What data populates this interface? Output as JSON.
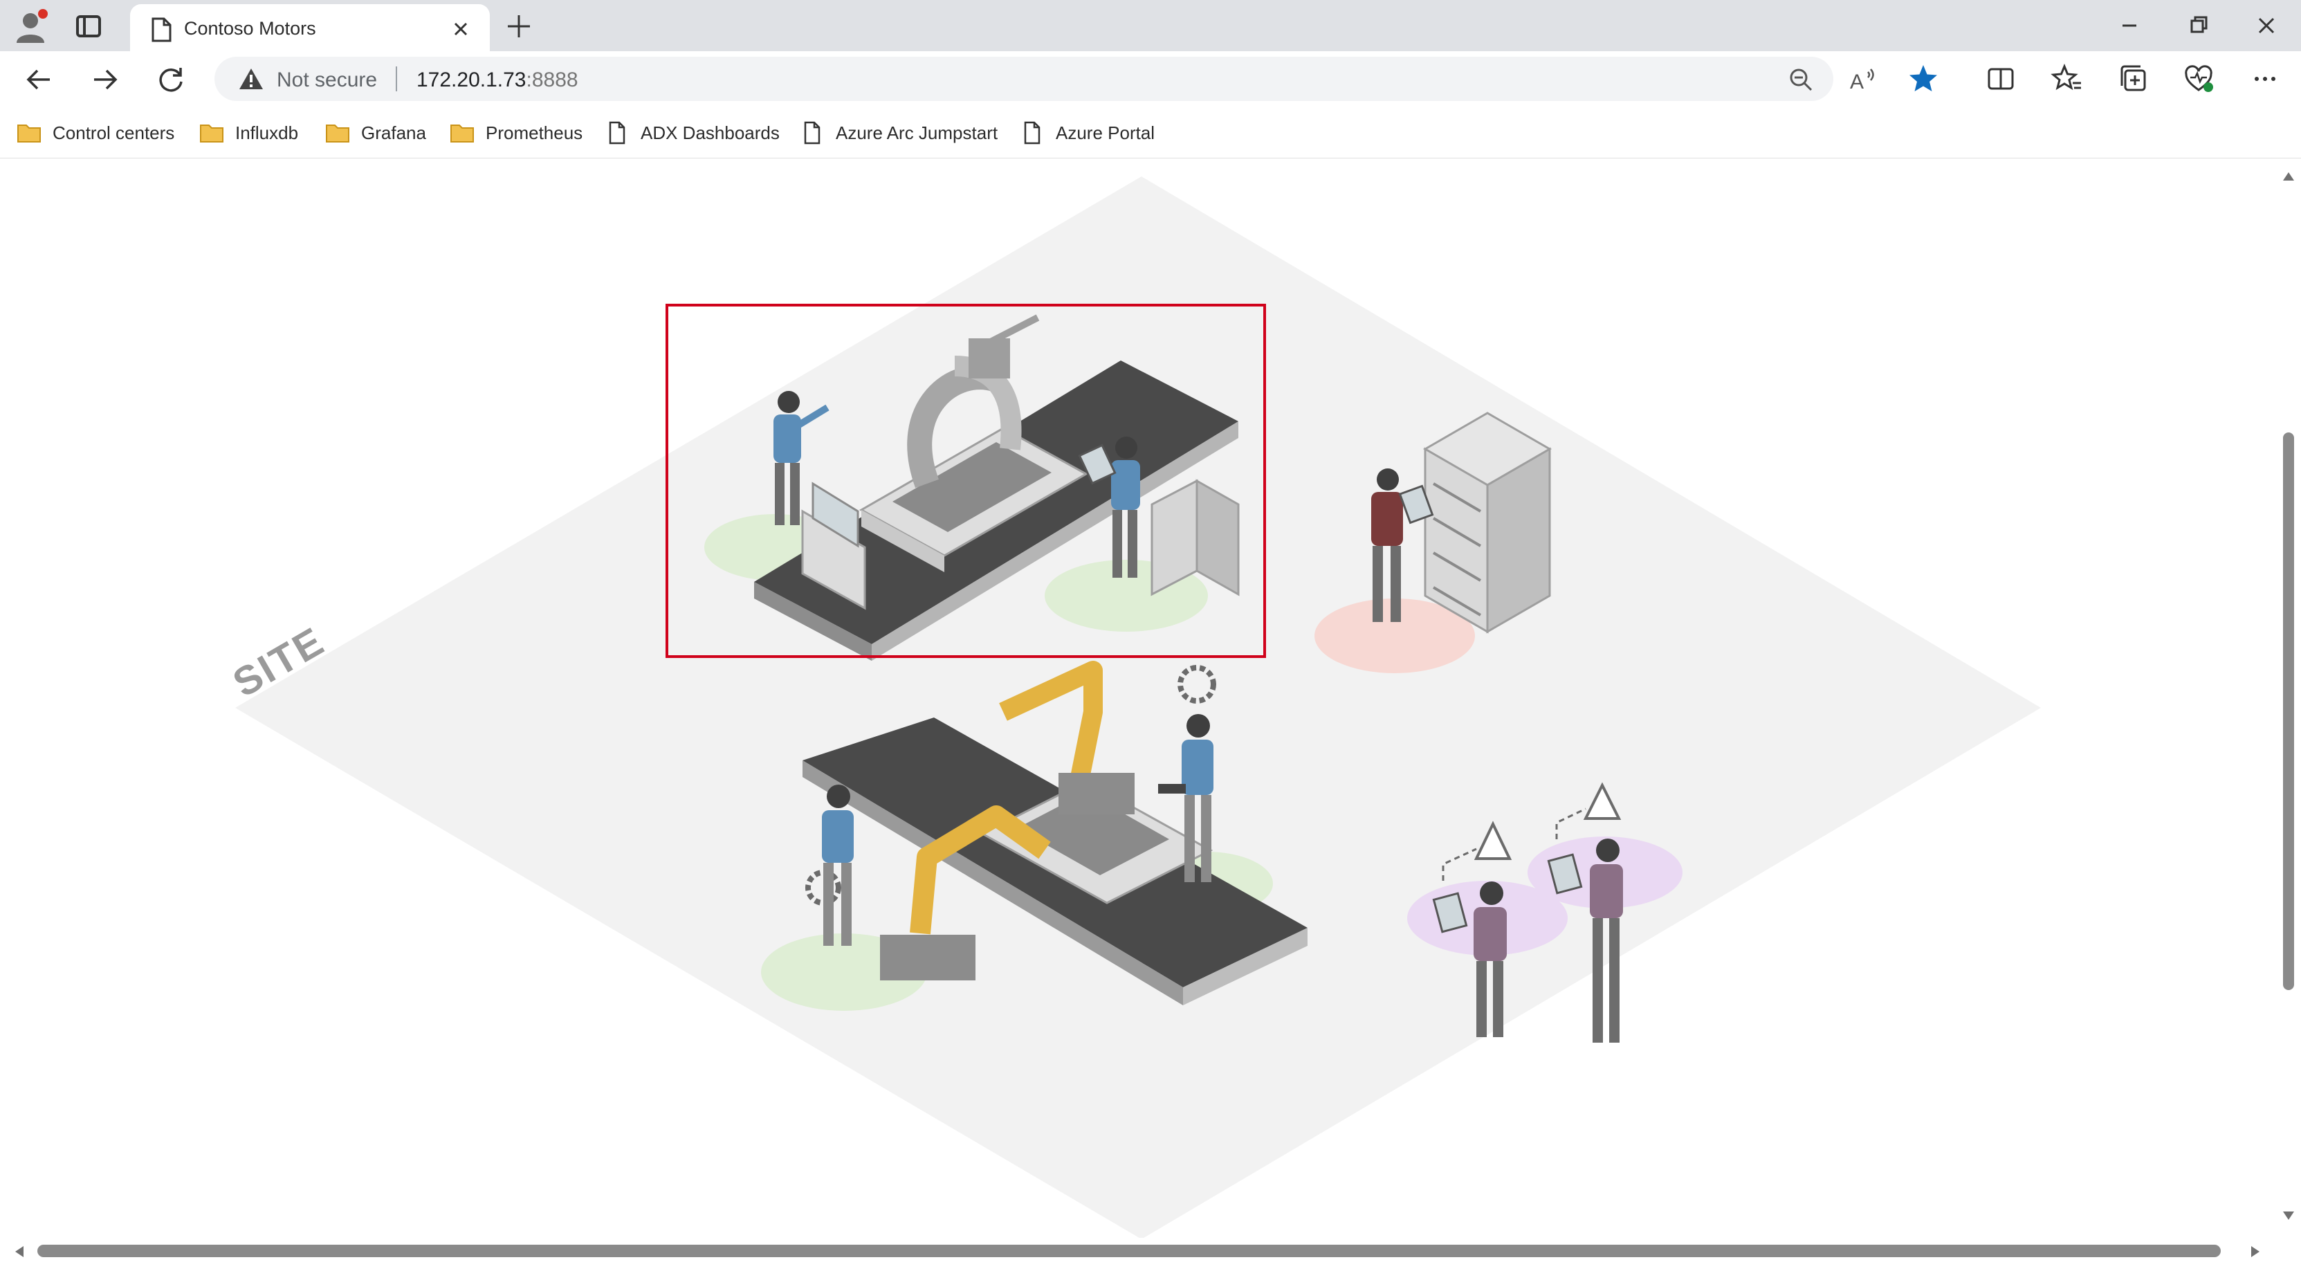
{
  "tab": {
    "title": "Contoso Motors"
  },
  "address": {
    "security_label": "Not secure",
    "host": "172.20.1.73",
    "port": ":8888"
  },
  "favorites": [
    {
      "label": "Control centers",
      "icon": "folder-icon"
    },
    {
      "label": "Influxdb",
      "icon": "folder-icon"
    },
    {
      "label": "Grafana",
      "icon": "folder-icon"
    },
    {
      "label": "Prometheus",
      "icon": "folder-icon"
    },
    {
      "label": "ADX Dashboards",
      "icon": "page-icon"
    },
    {
      "label": "Azure Arc Jumpstart",
      "icon": "page-icon"
    },
    {
      "label": "Azure Portal",
      "icon": "page-icon"
    }
  ],
  "scene": {
    "site_label": "SITE",
    "zones": [
      "assembly-line-highlighted",
      "server-rack-technician",
      "robotic-welding-line",
      "workers-with-alerts"
    ]
  },
  "colors": {
    "tabstrip": "#dfe1e5",
    "highlight_box": "#d0021b",
    "favorite_star": "#0f6cbd",
    "folder": "#f2c14e",
    "worker_shirt": "#5b8db8",
    "robot_arm": "#e3b341",
    "ground_green": "#dfeed5",
    "ground_red": "#f7d8d3",
    "ground_purple": "#ead9f3"
  }
}
